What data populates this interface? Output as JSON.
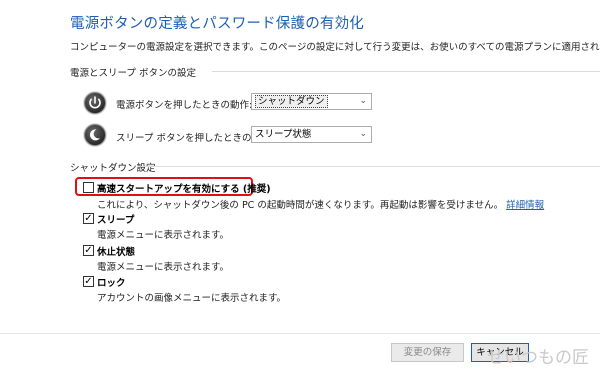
{
  "header": {
    "title": "電源ボタンの定義とパスワード保護の有効化",
    "description": "コンピューターの電源設定を選択できます。このページの設定に対して行う変更は、お使いのすべての電源プランに適用されます。"
  },
  "power_section": {
    "label": "電源とスリープ ボタンの設定",
    "rows": [
      {
        "label": "電源ボタンを押したときの動作:",
        "value": "シャットダウン",
        "icon": "power-button-icon"
      },
      {
        "label": "スリープ ボタンを押したときの動作:",
        "value": "スリープ状態",
        "icon": "sleep-button-icon"
      }
    ]
  },
  "shutdown_section": {
    "label": "シャットダウン設定",
    "options": [
      {
        "title": "高速スタートアップを有効にする (推奨)",
        "checked": false,
        "sub": "これにより、シャットダウン後の PC の起動時間が速くなります。再起動は影響を受けません。",
        "link": "詳細情報",
        "highlighted": true
      },
      {
        "title": "スリープ",
        "checked": true,
        "sub": "電源メニューに表示されます。"
      },
      {
        "title": "休止状態",
        "checked": true,
        "sub": "電源メニューに表示されます。"
      },
      {
        "title": "ロック",
        "checked": true,
        "sub": "アカウントの画像メニューに表示されます。"
      }
    ]
  },
  "footer": {
    "save_label": "変更の保存",
    "cancel_label": "キャンセル"
  },
  "watermark": "せいつもの匠",
  "colors": {
    "title": "#1e5fb4",
    "link": "#1e5fb4",
    "highlight_border": "#e01010"
  }
}
